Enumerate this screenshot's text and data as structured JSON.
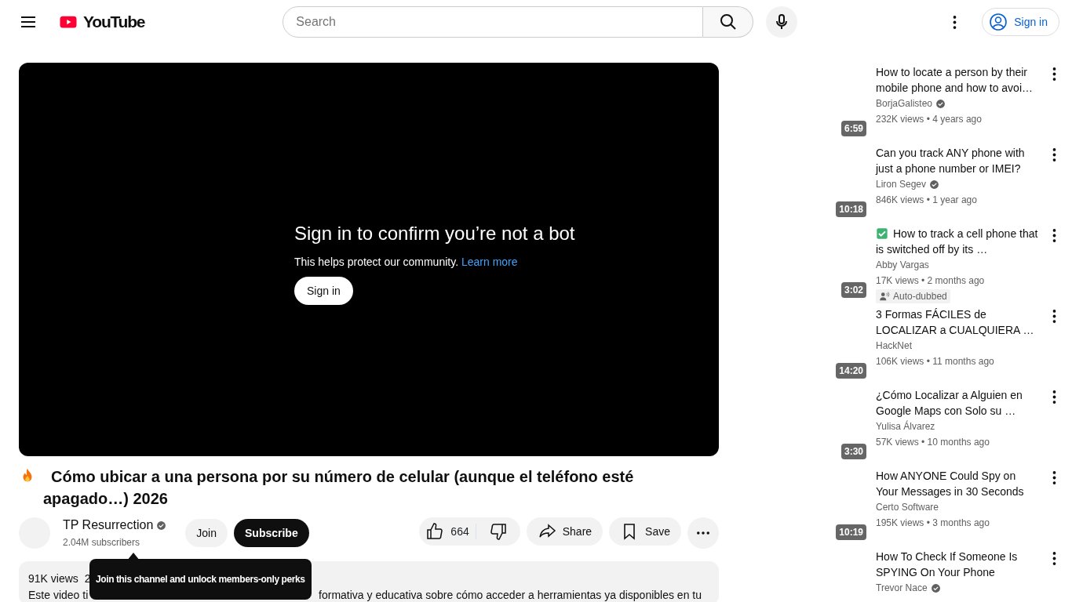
{
  "header": {
    "logo_text": "YouTube",
    "search": {
      "placeholder": "Search"
    },
    "sign_in": "Sign in"
  },
  "player": {
    "heading": "Sign in to confirm you’re not a bot",
    "message": "This helps protect our community.",
    "link": "Learn more",
    "button": "Sign in"
  },
  "video": {
    "title": "Cómo ubicar a una persona por su número de celular (aunque el teléfono esté apagado…) 2026",
    "channel": "TP Resurrection",
    "verified": true,
    "subscribers": "2.04M subscribers",
    "join": "Join",
    "subscribe": "Subscribe",
    "likes": "664",
    "share": "Share",
    "save": "Save"
  },
  "tooltip": "Join this channel and unlock members-only perks",
  "description": {
    "views": "91K views",
    "date_fragment": "2",
    "text_start": "Este video ti",
    "text_end": "formativa y educativa sobre cómo acceder a herramientas ya disponibles en tu"
  },
  "related": [
    {
      "title": "How to locate a person by their mobile phone and how to avoi…",
      "channel": "BorjaGalisteo",
      "verified": true,
      "meta": "232K views • 4 years ago",
      "duration": "6:59",
      "check_mark": false
    },
    {
      "title": "Can you track ANY phone with just a phone number or IMEI?",
      "channel": "Liron Segev",
      "verified": true,
      "meta": "846K views • 1 year ago",
      "duration": "10:18",
      "check_mark": false
    },
    {
      "title": "How to track a cell phone that is switched off by its …",
      "channel": "Abby Vargas",
      "verified": false,
      "meta": "17K views • 2 months ago",
      "duration": "3:02",
      "check_mark": true,
      "badge": "Auto-dubbed"
    },
    {
      "title": "3 Formas FÁCILES de LOCALIZAR a CUALQUIERA …",
      "channel": "HackNet",
      "verified": false,
      "meta": "106K views • 11 months ago",
      "duration": "14:20",
      "check_mark": false
    },
    {
      "title": "¿Cómo Localizar a Alguien en Google Maps con Solo su …",
      "channel": "Yulisa Álvarez",
      "verified": false,
      "meta": "57K views • 10 months ago",
      "duration": "3:30",
      "check_mark": false
    },
    {
      "title": "How ANYONE Could Spy on Your Messages in 30 Seconds",
      "channel": "Certo Software",
      "verified": false,
      "meta": "195K views • 3 months ago",
      "duration": "10:19",
      "check_mark": false
    },
    {
      "title": "How To Check If Someone Is SPYING On Your Phone",
      "channel": "Trevor Nace",
      "verified": true,
      "check_mark": false
    }
  ]
}
